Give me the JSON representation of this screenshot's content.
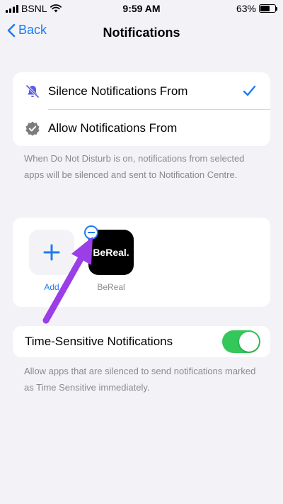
{
  "status_bar": {
    "carrier": "BSNL",
    "time": "9:59 AM",
    "battery": "63%",
    "battery_level": 0.63
  },
  "nav": {
    "back_label": "Back",
    "title": "Notifications"
  },
  "silence_section": {
    "options": [
      {
        "label": "Silence Notifications From",
        "icon": "bell-slash-icon",
        "selected": true
      },
      {
        "label": "Allow Notifications From",
        "icon": "check-badge-icon",
        "selected": false
      }
    ],
    "footnote": "When Do Not Disturb is on, notifications from selected apps will be silenced and sent to Notification Centre."
  },
  "apps_section": {
    "add_label": "Add",
    "apps": [
      {
        "name": "BeReal",
        "icon_text": "BeReal."
      }
    ]
  },
  "time_sensitive": {
    "label": "Time-Sensitive Notifications",
    "enabled": true,
    "footnote": "Allow apps that are silenced to send notifications marked as Time Sensitive immediately."
  },
  "colors": {
    "accent": "#1e7cf2",
    "toggle_on": "#34c759",
    "annotation_arrow": "#9b3ee8"
  }
}
